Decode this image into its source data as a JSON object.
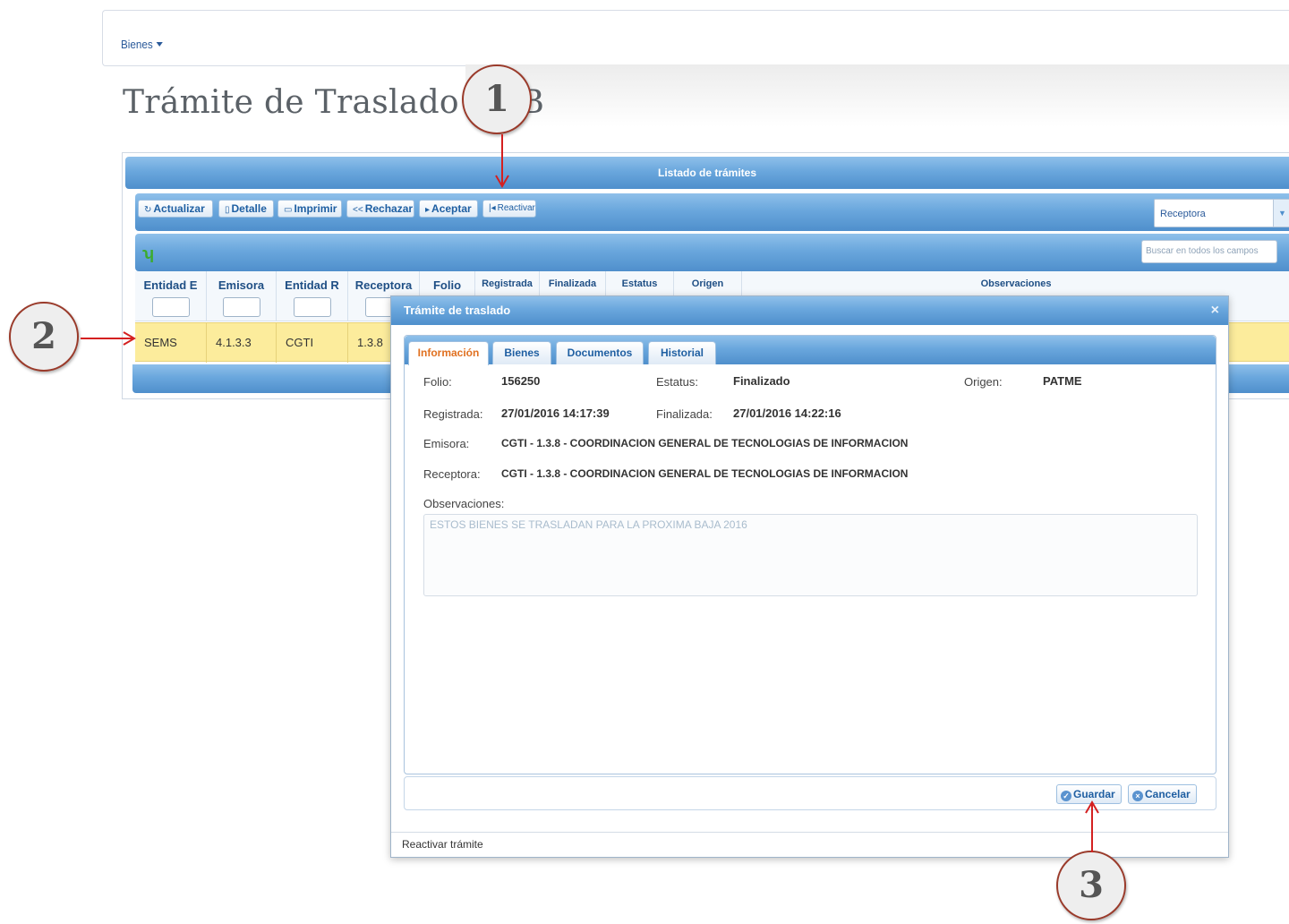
{
  "topbar": {
    "menu_label": "Bienes"
  },
  "page_title": "Trámite de Traslado de B",
  "grid": {
    "caption": "Listado de trámites",
    "toolbar": {
      "actualizar": "Actualizar",
      "detalle": "Detalle",
      "imprimir": "Imprimir",
      "rechazar": "Rechazar",
      "aceptar": "Aceptar",
      "reactivar": "Reactivar",
      "filter_select_value": "Receptora"
    },
    "search_placeholder": "Buscar en todos los campos",
    "columns": [
      "Entidad E",
      "Emisora",
      "Entidad R",
      "Receptora",
      "Folio",
      "Registrada",
      "Finalizada",
      "Estatus",
      "Origen",
      "Observaciones"
    ],
    "row": [
      "SEMS",
      "4.1.3.3",
      "CGTI",
      "1.3.8"
    ]
  },
  "modal": {
    "title": "Trámite de traslado",
    "close_glyph": "×",
    "tabs": [
      "Información",
      "Bienes",
      "Documentos",
      "Historial"
    ],
    "labels": {
      "folio": "Folio:",
      "estatus": "Estatus:",
      "origen": "Origen:",
      "registrada": "Registrada:",
      "finalizada": "Finalizada:",
      "emisora": "Emisora:",
      "receptora": "Receptora:",
      "observaciones": "Observaciones:"
    },
    "values": {
      "folio": "156250",
      "estatus": "Finalizado",
      "origen": "PATME",
      "registrada": "27/01/2016 14:17:39",
      "finalizada": "27/01/2016 14:22:16",
      "emisora": "CGTI - 1.3.8 - COORDINACION GENERAL DE TECNOLOGIAS DE INFORMACION",
      "receptora": "CGTI - 1.3.8 - COORDINACION GENERAL DE TECNOLOGIAS DE INFORMACION",
      "observaciones": "ESTOS BIENES SE TRASLADAN PARA LA PROXIMA BAJA 2016"
    },
    "buttons": {
      "guardar": "Guardar",
      "cancelar": "Cancelar"
    },
    "status": "Reactivar trámite"
  },
  "callouts": [
    "1",
    "2",
    "3"
  ],
  "colors": {
    "header_blue": "#4f8fcc",
    "row_highlight": "#fcec9c",
    "active_tab": "#e07020",
    "callout_arrow": "#d42020"
  }
}
